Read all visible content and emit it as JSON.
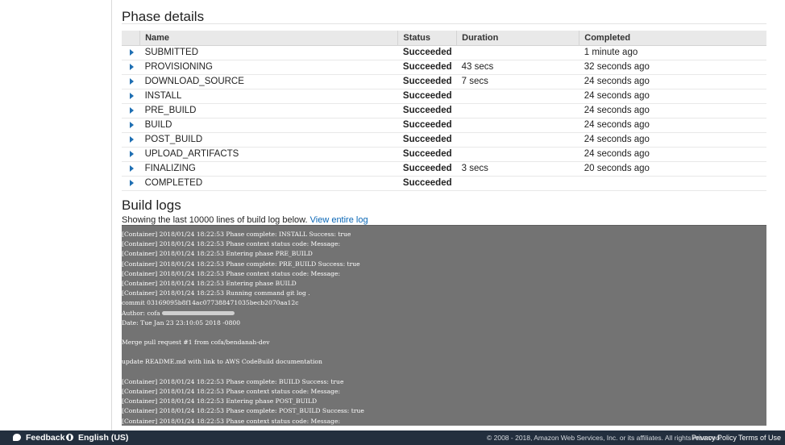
{
  "phase_details": {
    "title": "Phase details",
    "columns": {
      "name": "Name",
      "status": "Status",
      "duration": "Duration",
      "completed": "Completed"
    },
    "rows": [
      {
        "name": "SUBMITTED",
        "status": "Succeeded",
        "duration": "",
        "completed": "1 minute ago"
      },
      {
        "name": "PROVISIONING",
        "status": "Succeeded",
        "duration": "43 secs",
        "completed": "32 seconds ago"
      },
      {
        "name": "DOWNLOAD_SOURCE",
        "status": "Succeeded",
        "duration": "7 secs",
        "completed": "24 seconds ago"
      },
      {
        "name": "INSTALL",
        "status": "Succeeded",
        "duration": "",
        "completed": "24 seconds ago"
      },
      {
        "name": "PRE_BUILD",
        "status": "Succeeded",
        "duration": "",
        "completed": "24 seconds ago"
      },
      {
        "name": "BUILD",
        "status": "Succeeded",
        "duration": "",
        "completed": "24 seconds ago"
      },
      {
        "name": "POST_BUILD",
        "status": "Succeeded",
        "duration": "",
        "completed": "24 seconds ago"
      },
      {
        "name": "UPLOAD_ARTIFACTS",
        "status": "Succeeded",
        "duration": "",
        "completed": "24 seconds ago"
      },
      {
        "name": "FINALIZING",
        "status": "Succeeded",
        "duration": "3 secs",
        "completed": "20 seconds ago"
      },
      {
        "name": "COMPLETED",
        "status": "Succeeded",
        "duration": "",
        "completed": ""
      }
    ]
  },
  "build_logs": {
    "title": "Build logs",
    "caption": "Showing the last 10000 lines of build log below.",
    "view_link": "View entire log",
    "lines": [
      "[Container] 2018/01/24 18:22:53 Phase complete: INSTALL Success: true",
      "[Container] 2018/01/24 18:22:53 Phase context status code: Message:",
      "[Container] 2018/01/24 18:22:53 Entering phase PRE_BUILD",
      "[Container] 2018/01/24 18:22:53 Phase complete: PRE_BUILD Success: true",
      "[Container] 2018/01/24 18:22:53 Phase context status code: Message:",
      "[Container] 2018/01/24 18:22:53 Entering phase BUILD",
      "[Container] 2018/01/24 18:22:53 Running command git log .",
      "commit 03169095b8f14ac077388471035becb2070aa12c",
      "Author: cofa",
      "Date: Tue Jan 23 23:10:05 2018 -0800",
      "",
      "Merge pull request #1 from cofa/bendanah-dev",
      "",
      "update README.md with link to AWS CodeBuild documentation",
      "",
      "[Container] 2018/01/24 18:22:53 Phase complete: BUILD Success: true",
      "[Container] 2018/01/24 18:22:53 Phase context status code: Message:",
      "[Container] 2018/01/24 18:22:53 Entering phase POST_BUILD",
      "[Container] 2018/01/24 18:22:53 Phase complete: POST_BUILD Success: true",
      "[Container] 2018/01/24 18:22:53 Phase context status code: Message:"
    ]
  },
  "footer": {
    "feedback": "Feedback",
    "language": "English (US)",
    "copyright": "© 2008 - 2018, Amazon Web Services, Inc. or its affiliates. All rights reserved.",
    "privacy": "Privacy Policy",
    "terms": "Terms of Use"
  },
  "colors": {
    "status_success": "#1d8102",
    "link": "#0a67b6",
    "log_background": "#737373",
    "footer_background": "#232f3e"
  }
}
